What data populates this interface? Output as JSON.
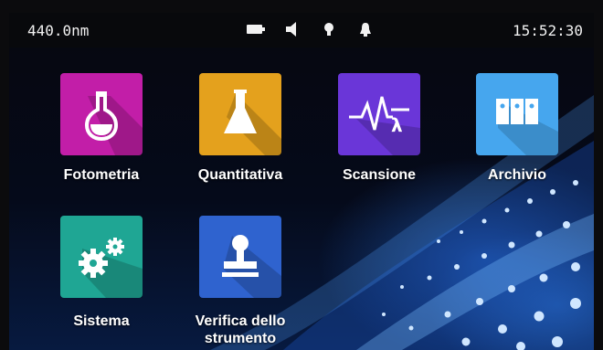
{
  "status": {
    "wavelength": "440.0nm",
    "time": "15:52:30",
    "icons": [
      "battery-icon",
      "speaker-icon",
      "lamp-icon",
      "bell-icon"
    ]
  },
  "apps": [
    {
      "label": "Fotometria",
      "icon": "flask-icon",
      "color": "#c21ea8"
    },
    {
      "label": "Quantitativa",
      "icon": "beaker-icon",
      "color": "#e4a11d"
    },
    {
      "label": "Scansione",
      "icon": "waveform-lambda-icon",
      "color": "#6a36d8",
      "glyph": "λ"
    },
    {
      "label": "Archivio",
      "icon": "binders-icon",
      "color": "#46a6ee"
    },
    {
      "label": "Sistema",
      "icon": "gears-icon",
      "color": "#1fa694"
    },
    {
      "label": "Verifica dello\nstrumento",
      "line1": "Verifica dello",
      "line2": "strumento",
      "icon": "stamp-icon",
      "color": "#2f63cf"
    }
  ]
}
